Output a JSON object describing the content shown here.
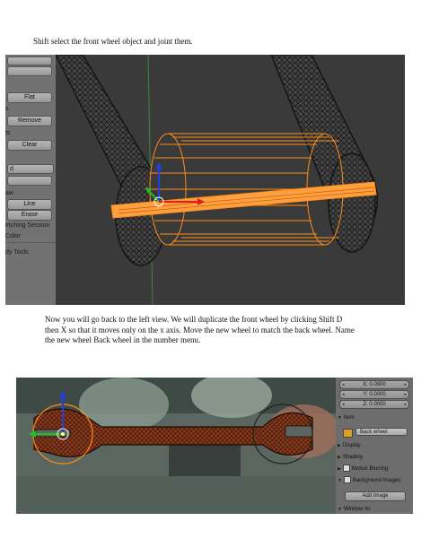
{
  "instructions": {
    "step1": "Shift select the front wheel object and joint them.",
    "step2": "Now you will go back to the left view. We will duplicate the front wheel by clicking Shift D then X so that it moves only on the x axis. Move the new wheel to match the back wheel. Name the new wheel Back wheel in the number menu."
  },
  "toolshelf": {
    "flat_btn": "Flat",
    "remove_btn": "Remove",
    "clear_btn": "Clear",
    "line_btn": "Line",
    "erase_btn": "Erase",
    "sculpt_session": "etching Session",
    "color_label": "Color",
    "body_tools": "dy Tools",
    "frag_a": "",
    "frag_b": "ts",
    "frag_c": "d",
    "frag_d": "aw"
  },
  "properties": {
    "x_value": "X: 0.0000",
    "y_value": "Y: 0.0000",
    "z_value": "Z: 0.0000",
    "item_header": "Item",
    "object_name": "Back wheel",
    "display_header": "Display",
    "shading_header": "Shading",
    "motion_blur_header": "Motion Blurring",
    "bg_images_header": "Background Images",
    "add_image_btn": "Add Image",
    "bottom_item": "Window Im"
  },
  "colors": {
    "wire_selected": "#ff8c1a",
    "wire_dark": "#121212",
    "viewport_bg": "#3a3a3a",
    "axis_x": "#e02020",
    "axis_y": "#20c020",
    "axis_z": "#2040e0",
    "wrench_fill": "#8a3a1c"
  }
}
